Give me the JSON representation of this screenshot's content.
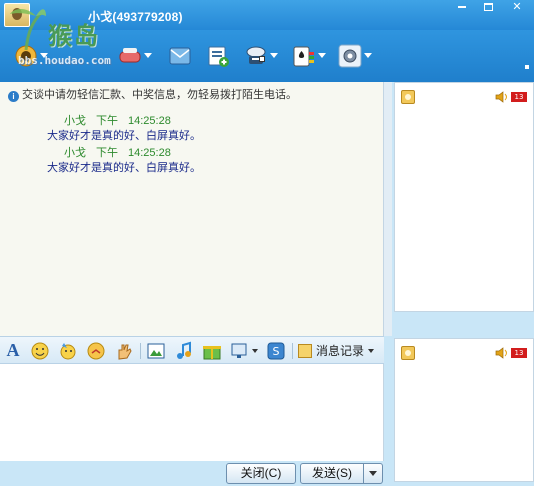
{
  "window": {
    "title": "小戈(493779208)",
    "controls": [
      "minimize",
      "maximize",
      "close"
    ]
  },
  "watermark": {
    "brand": "猴岛",
    "url": "bbs.houdao.com"
  },
  "toolbar": {
    "items": [
      {
        "icon": "video-call-icon"
      },
      {
        "icon": "voice-call-icon"
      },
      {
        "icon": "send-file-icon"
      },
      {
        "icon": "send-message-icon"
      },
      {
        "icon": "remote-assist-icon"
      },
      {
        "icon": "games-icon"
      },
      {
        "icon": "app-settings-icon"
      }
    ]
  },
  "chat": {
    "notice": "交谈中请勿轻信汇款、中奖信息，勿轻易拨打陌生电话。",
    "messages": [
      {
        "sender": "小戈",
        "period": "下午",
        "time": "14:25:28",
        "text": "大家好才是真的好、白屏真好。"
      },
      {
        "sender": "小戈",
        "period": "下午",
        "time": "14:25:28",
        "text": "大家好才是真的好、白屏真好。"
      }
    ]
  },
  "format_toolbar": {
    "font_label": "A",
    "history_label": "消息记录"
  },
  "right_panel": {
    "badge": "13"
  },
  "buttons": {
    "close": "关闭(C)",
    "send": "发送(S)"
  },
  "colors": {
    "titlebar": "#2f95df",
    "chat_bg": "#f7f8f1",
    "sender_green": "#2d8a2d",
    "message_blue": "#1a2a8a",
    "badge_red": "#d21d1d"
  }
}
